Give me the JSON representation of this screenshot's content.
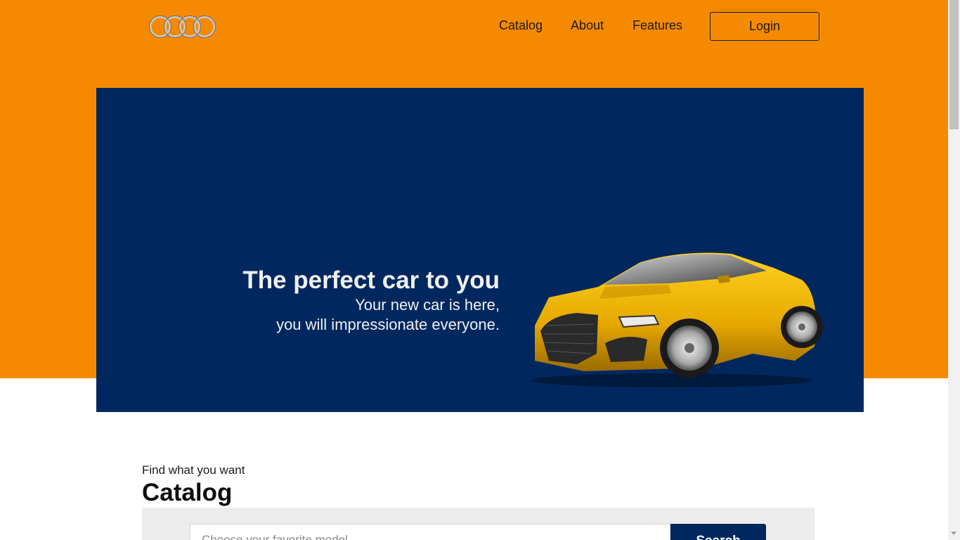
{
  "brand": {
    "logo_icon": "audi-rings-logo",
    "colors": {
      "primary": "#f58a00",
      "navy": "#00285f"
    }
  },
  "nav": {
    "links": [
      "Catalog",
      "About",
      "Features"
    ],
    "login_label": "Login"
  },
  "hero": {
    "title": "The perfect car to you",
    "subtitle_line1": "Your new car is here,",
    "subtitle_line2": "you will impressionate everyone.",
    "image_icon": "yellow-sports-car-image"
  },
  "catalog": {
    "kicker": "Find what you want",
    "title": "Catalog",
    "search_placeholder": "Choose your favorite model",
    "search_button": "Search"
  }
}
